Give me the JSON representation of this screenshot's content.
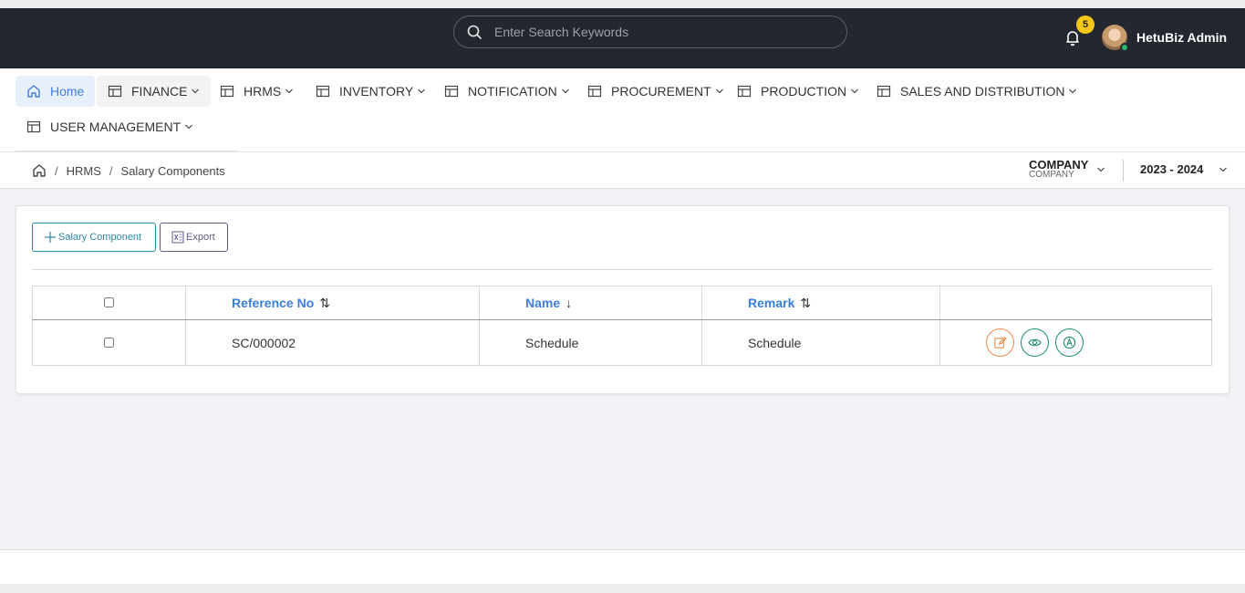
{
  "header": {
    "search_placeholder": "Enter Search Keywords",
    "notification_count": "5",
    "user_name": "HetuBiz Admin"
  },
  "nav": {
    "items": [
      {
        "label": "Home",
        "icon": "home-icon"
      },
      {
        "label": "FINANCE",
        "icon": "table-icon"
      },
      {
        "label": "HRMS",
        "icon": "table-icon"
      },
      {
        "label": "INVENTORY",
        "icon": "table-icon"
      },
      {
        "label": "NOTIFICATION",
        "icon": "table-icon"
      },
      {
        "label": "PROCUREMENT",
        "icon": "table-icon"
      },
      {
        "label": "PRODUCTION",
        "icon": "table-icon"
      },
      {
        "label": "SALES AND DISTRIBUTION",
        "icon": "table-icon"
      },
      {
        "label": "USER MANAGEMENT",
        "icon": "table-icon"
      }
    ]
  },
  "breadcrumb": {
    "items": [
      "HRMS",
      "Salary Components"
    ],
    "separator": "/"
  },
  "context": {
    "company_label": "COMPANY",
    "company_sub": "COMPANY",
    "year": "2023 - 2024"
  },
  "toolbar": {
    "add_label": "Salary Component",
    "export_label": "Export"
  },
  "table": {
    "columns": [
      {
        "label": "Reference No",
        "sort": "⇅"
      },
      {
        "label": "Name",
        "sort": "↓"
      },
      {
        "label": "Remark",
        "sort": "⇅"
      }
    ],
    "rows": [
      {
        "reference_no": "SC/000002",
        "name": "Schedule",
        "remark": "Schedule"
      }
    ]
  },
  "colors": {
    "topbar": "#23272f",
    "accent": "#3a7ee0",
    "edit": "#e88a4a",
    "view": "#1f8f6a",
    "badge": "#f5c518"
  }
}
